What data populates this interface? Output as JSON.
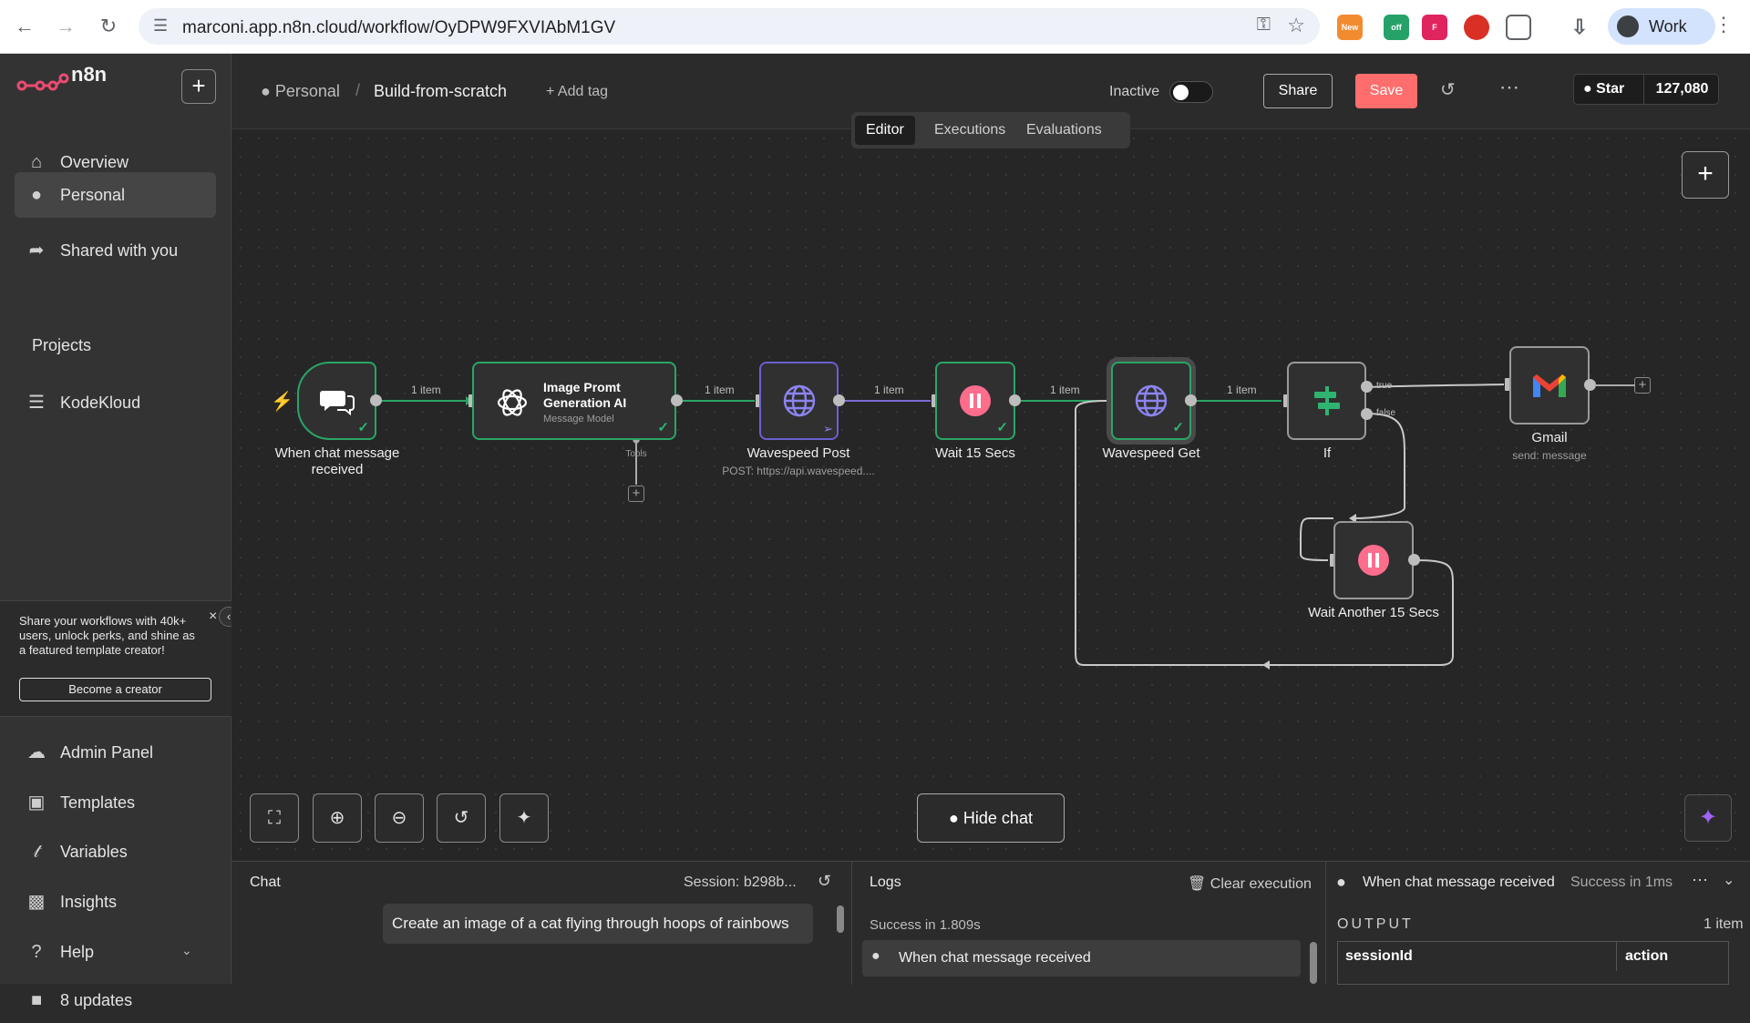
{
  "browser": {
    "url": "marconi.app.n8n.cloud/workflow/OyDPW9FXVIAbM1GV",
    "profile_label": "Work"
  },
  "sidebar": {
    "brand": "n8n",
    "items_top": [
      {
        "label": "Overview",
        "icon": "home-icon"
      },
      {
        "label": "Personal",
        "icon": "user-icon"
      },
      {
        "label": "Shared with you",
        "icon": "share-icon"
      }
    ],
    "projects_header": "Projects",
    "projects": [
      {
        "label": "KodeKloud",
        "icon": "layers-icon"
      }
    ],
    "promo": {
      "text": "Share your workflows with 40k+ users, unlock perks, and shine as a featured template creator!",
      "button": "Become a creator"
    },
    "items_bottom": [
      {
        "label": "Admin Panel",
        "icon": "cloud-icon"
      },
      {
        "label": "Templates",
        "icon": "box-icon"
      },
      {
        "label": "Variables",
        "icon": "variable-icon"
      },
      {
        "label": "Insights",
        "icon": "chart-icon"
      },
      {
        "label": "Help",
        "icon": "help-icon"
      },
      {
        "label": "8 updates",
        "icon": "gift-icon"
      }
    ]
  },
  "header": {
    "breadcrumb_project": "Personal",
    "workflow_name": "Build-from-scratch",
    "add_tag": "+ Add tag",
    "status_label": "Inactive",
    "share": "Share",
    "save": "Save",
    "github_star": "Star",
    "github_count": "127,080",
    "accent_color": "#ff6d6d"
  },
  "tabs": [
    {
      "label": "Editor",
      "active": true
    },
    {
      "label": "Executions",
      "active": false
    },
    {
      "label": "Evaluations",
      "active": false
    }
  ],
  "workflow": {
    "nodes": [
      {
        "name": "When chat message received",
        "subtitle": "",
        "status": "success"
      },
      {
        "name": "Image Promt Generation AI",
        "subtitle": "Message Model",
        "status": "success"
      },
      {
        "name": "Wavespeed Post",
        "subtitle": "POST: https://api.wavespeed....",
        "status": "pinned"
      },
      {
        "name": "Wait 15 Secs",
        "subtitle": "",
        "status": "success"
      },
      {
        "name": "Wavespeed Get",
        "subtitle": "",
        "status": "success"
      },
      {
        "name": "If",
        "subtitle": "",
        "status": "idle"
      },
      {
        "name": "Gmail",
        "subtitle": "send: message",
        "status": "idle"
      },
      {
        "name": "Wait Another 15 Secs",
        "subtitle": "",
        "status": "idle"
      }
    ],
    "edge_labels": [
      "1 item",
      "1 item",
      "1 item",
      "1 item",
      "1 item"
    ],
    "tools_label": "Tools",
    "if_true": "true",
    "if_false": "false"
  },
  "canvas_controls": {
    "hide_chat": "Hide chat"
  },
  "chat_panel": {
    "title": "Chat",
    "session": "Session: b298b...",
    "message": "Create an image of a cat flying through hoops of rainbows"
  },
  "logs_panel": {
    "title": "Logs",
    "clear": "Clear execution",
    "status": "Success in 1.809s",
    "entry": "When chat message received"
  },
  "output_panel": {
    "node": "When chat message received",
    "status": "Success in 1ms",
    "label": "OUTPUT",
    "items": "1 item",
    "columns": [
      "sessionId",
      "action"
    ]
  }
}
